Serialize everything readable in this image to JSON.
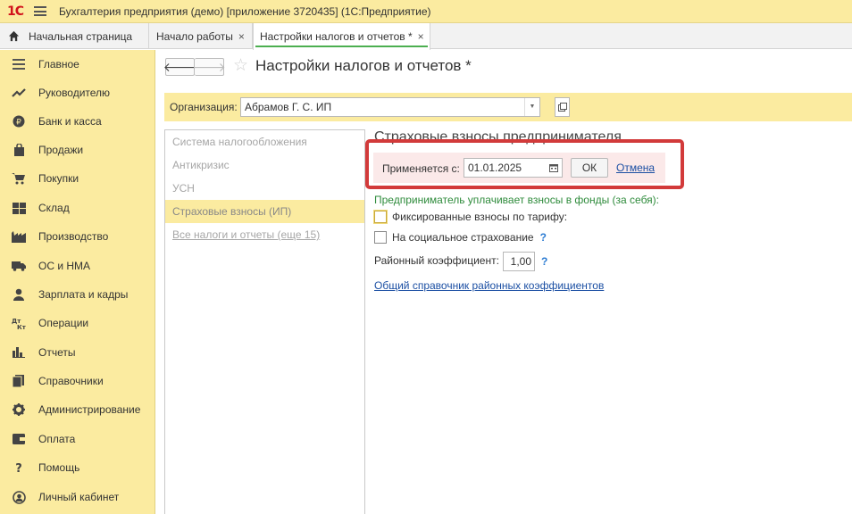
{
  "app": {
    "logo": "1С",
    "title": "Бухгалтерия предприятия (демо) [приложение 3720435]  (1С:Предприятие)"
  },
  "tabs": {
    "home": "Начальная страница",
    "work": "Начало работы",
    "active": "Настройки налогов и отчетов *",
    "close": "×"
  },
  "sidebar": {
    "items": [
      {
        "label": "Главное",
        "icon": "menu-lines-icon"
      },
      {
        "label": "Руководителю",
        "icon": "trend-icon"
      },
      {
        "label": "Банк и касса",
        "icon": "coin-icon"
      },
      {
        "label": "Продажи",
        "icon": "bag-icon"
      },
      {
        "label": "Покупки",
        "icon": "cart-icon"
      },
      {
        "label": "Склад",
        "icon": "warehouse-icon"
      },
      {
        "label": "Производство",
        "icon": "factory-icon"
      },
      {
        "label": "ОС и НМА",
        "icon": "truck-icon"
      },
      {
        "label": "Зарплата и кадры",
        "icon": "person-icon"
      },
      {
        "label": "Операции",
        "icon": "operations-icon"
      },
      {
        "label": "Отчеты",
        "icon": "bar-chart-icon"
      },
      {
        "label": "Справочники",
        "icon": "books-icon"
      },
      {
        "label": "Администрирование",
        "icon": "gear-icon"
      },
      {
        "label": "Оплата",
        "icon": "wallet-icon"
      },
      {
        "label": "Помощь",
        "icon": "question-icon"
      },
      {
        "label": "Личный кабинет",
        "icon": "account-icon"
      }
    ]
  },
  "page": {
    "title": "Настройки налогов и отчетов *",
    "back": "🡐",
    "forward": "🡒",
    "star": "☆"
  },
  "org": {
    "label": "Организация:",
    "value": "Абрамов Г. С. ИП"
  },
  "sections": {
    "items": [
      {
        "label": "Система налогообложения"
      },
      {
        "label": "Антикризис"
      },
      {
        "label": "УСН"
      },
      {
        "label": "Страховые взносы (ИП)"
      },
      {
        "label": "Все налоги и отчеты (еще 15)"
      }
    ]
  },
  "content": {
    "section_title": "Страховые взносы предпринимателя",
    "apply_label": "Применяется с:",
    "apply_date": "01.01.2025",
    "ok": "ОК",
    "cancel": "Отмена",
    "payer_text": "Предприниматель уплачивает взносы в фонды (за себя):",
    "fixed_label": "Фиксированные взносы по тарифу:",
    "fixed_checked": false,
    "social_label": "На социальное страхование",
    "social_checked": false,
    "help": "?",
    "coef_label": "Районный коэффициент:",
    "coef_value": "1,00",
    "ref_link": "Общий справочник районных коэффициентов"
  },
  "colors": {
    "accent_yellow": "#fbeba0",
    "highlight_red": "#d23a3a",
    "link_blue": "#1b4fa3",
    "green": "#2e8b3b"
  }
}
